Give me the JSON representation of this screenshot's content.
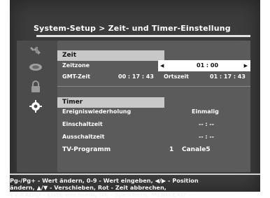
{
  "header": {
    "title": "System-Setup > Zeit- und Timer-Einstellung"
  },
  "sidebar": {
    "icons": [
      "tools-icon",
      "satellite-dish-icon",
      "padlock-icon",
      "gear-icon"
    ]
  },
  "time_section": {
    "heading": "Zeit",
    "timezone_label": "Zeitzone",
    "timezone_value": "01 : 00",
    "gmt_label": "GMT-Zeit",
    "gmt_value": "00 : 17 : 43",
    "local_label": "Ortszeit",
    "local_value": "01 : 17 : 43"
  },
  "timer_section": {
    "heading": "Timer",
    "repeat_label": "Ereigniswiederholung",
    "repeat_value": "Einmalig",
    "on_label": "Einschaltzeit",
    "on_value": "-- : --",
    "off_label": "Ausschaltzeit",
    "off_value": "-- : --",
    "program_label": "TV-Programm",
    "program_number": "1",
    "program_name": "Canale5"
  },
  "help": {
    "line1": "Pg-/Pg+ - Wert ändern, 0-9 - Wert eingeben, ◀/▶ - Position",
    "line2": "ändern, ▲/▼ - Verschieben, Rot - Zeit abbrechen,",
    "line3": "TV/RADIO - Liste wechseln, OK - Speichern, MENU/EXIT -"
  }
}
